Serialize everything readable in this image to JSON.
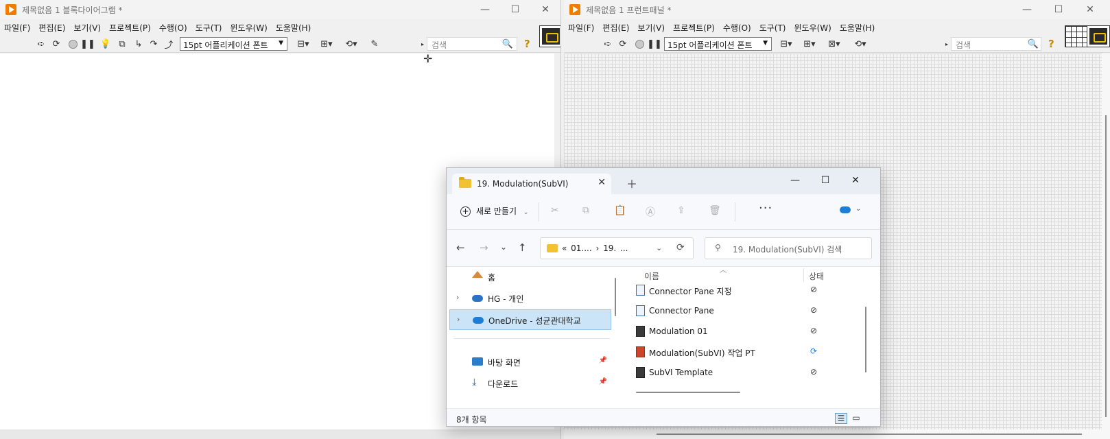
{
  "block_diagram": {
    "title": "제목없음 1 블록다이어그램 *",
    "menu": [
      "파일(F)",
      "편집(E)",
      "보기(V)",
      "프로젝트(P)",
      "수행(O)",
      "도구(T)",
      "윈도우(W)",
      "도움말(H)"
    ],
    "font_select": "15pt 어플리케이션 폰트",
    "search_placeholder": "검색"
  },
  "front_panel": {
    "title": "제목없음 1 프런트패널 *",
    "menu": [
      "파일(F)",
      "편집(E)",
      "보기(V)",
      "프로젝트(P)",
      "수행(O)",
      "도구(T)",
      "윈도우(W)",
      "도움말(H)"
    ],
    "font_select": "15pt 어플리케이션 폰트",
    "search_placeholder": "검색"
  },
  "window_controls": {
    "minimize": "—",
    "maximize": "☐",
    "close": "✕"
  },
  "explorer": {
    "tab_title": "19. Modulation(SubVI)",
    "new_button": "새로 만들기",
    "breadcrumb": "« 01....  ›  19. ...",
    "search_placeholder": "19. Modulation(SubVI) 검색",
    "nav_items": [
      {
        "label": "홈"
      },
      {
        "label": "HG - 개인"
      },
      {
        "label": "OneDrive - 성균관대학교"
      },
      {
        "label": "바탕 화면"
      },
      {
        "label": "다운로드"
      }
    ],
    "columns": {
      "name": "이름",
      "status": "상태"
    },
    "files": [
      {
        "name": "Connector Pane 지정",
        "status": "⊘"
      },
      {
        "name": "Connector Pane",
        "status": "⊘"
      },
      {
        "name": "Modulation 01",
        "status": "⊘"
      },
      {
        "name": "Modulation(SubVI) 작업 PT",
        "status": "⟳"
      },
      {
        "name": "SubVI Template",
        "status": "⊘"
      }
    ],
    "item_count": "8개 항목"
  }
}
